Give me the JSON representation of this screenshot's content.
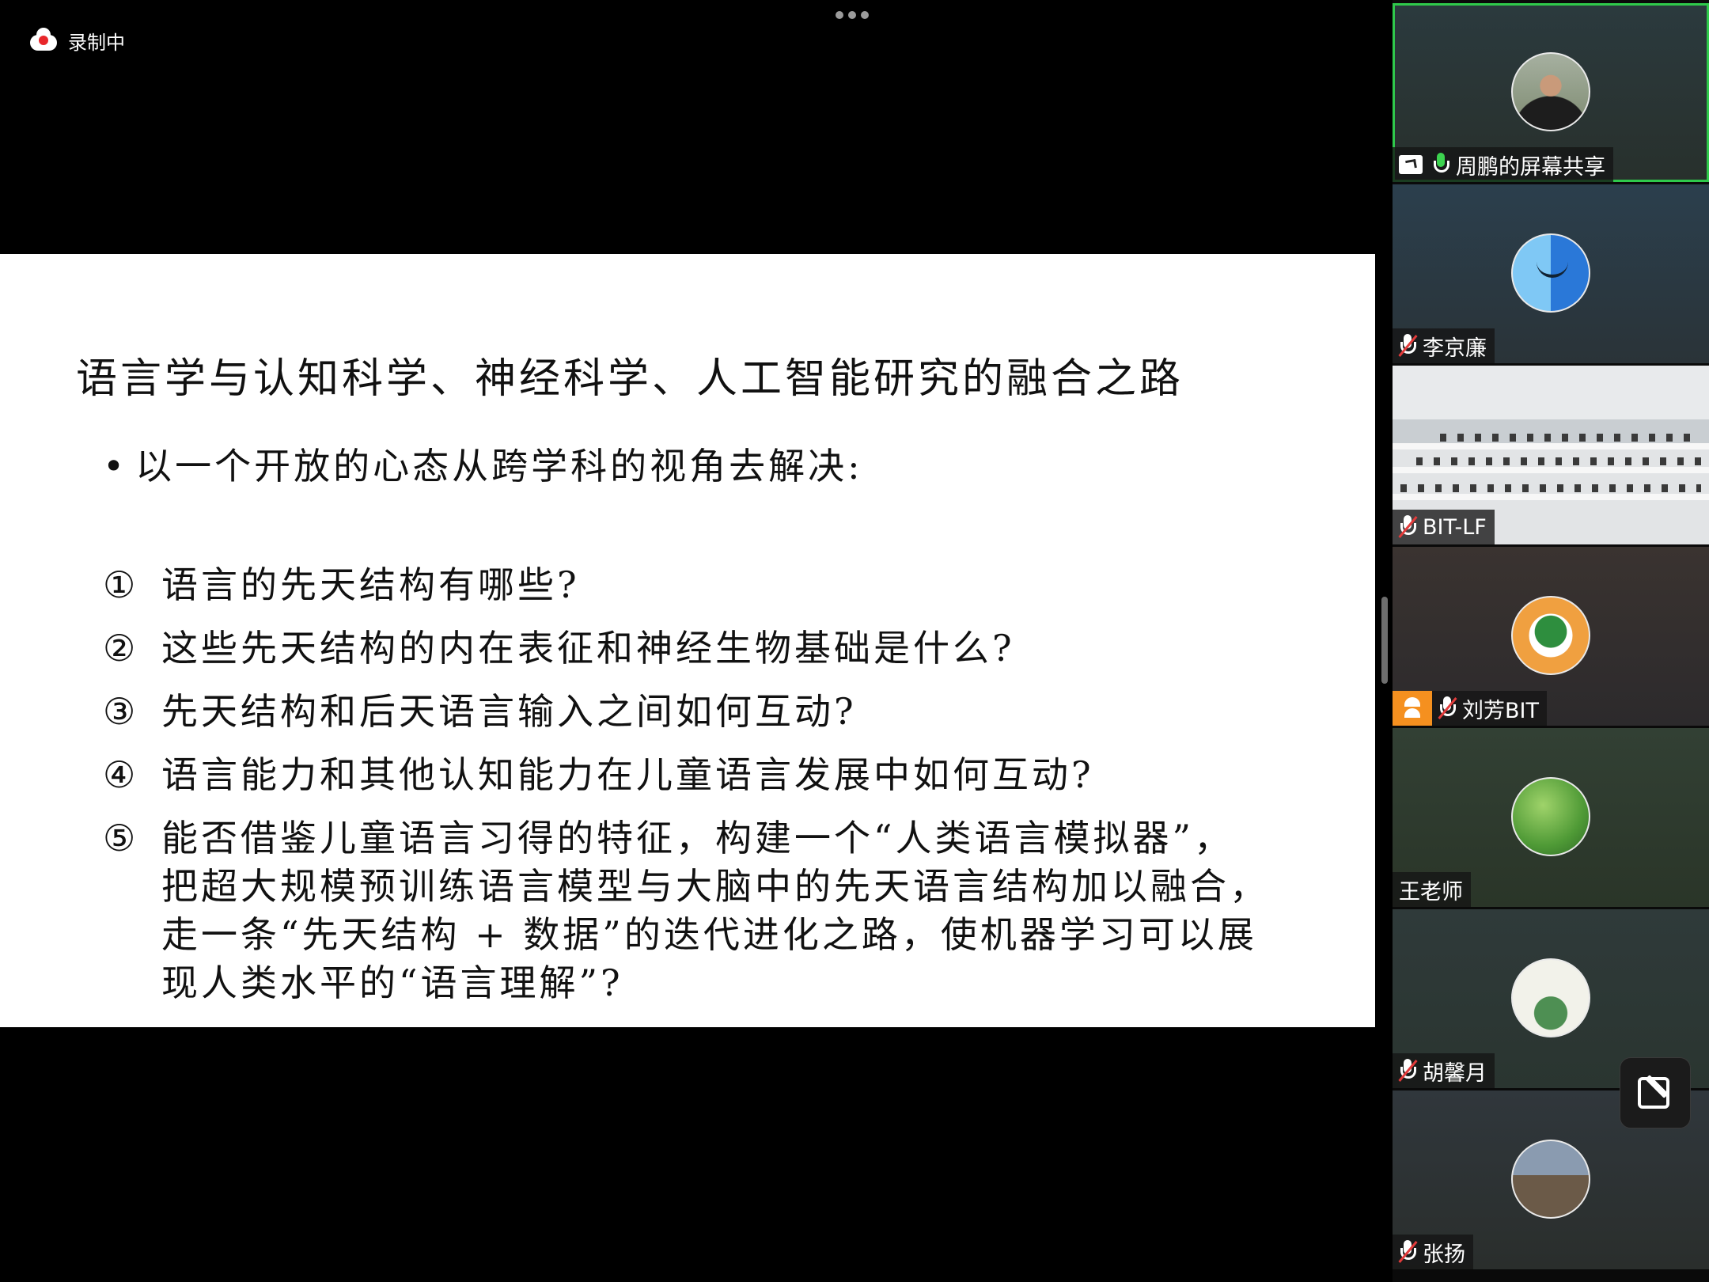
{
  "recording": {
    "label": "录制中"
  },
  "slide": {
    "title": "语言学与认知科学、神经科学、人工智能研究的融合之路",
    "bullet": "以一个开放的心态从跨学科的视角去解决:",
    "questions": [
      {
        "num": "①",
        "text": "语言的先天结构有哪些?"
      },
      {
        "num": "②",
        "text": "这些先天结构的内在表征和神经生物基础是什么?"
      },
      {
        "num": "③",
        "text": "先天结构和后天语言输入之间如何互动?"
      },
      {
        "num": "④",
        "text": "语言能力和其他认知能力在儿童语言发展中如何互动?"
      },
      {
        "num": "⑤",
        "text": "能否借鉴儿童语言习得的特征，构建一个“人类语言模拟器”，\n把超大规模预训练语言模型与大脑中的先天语言结构加以融合，\n走一条“先天结构 + 数据”的迭代进化之路，使机器学习可以展\n现人类水平的“语言理解”?"
      }
    ]
  },
  "participants": [
    {
      "name": "周鹏的屏幕共享",
      "mic": "on",
      "sharing": true,
      "active": true,
      "avatar": "man-portrait"
    },
    {
      "name": "李京廉",
      "mic": "muted",
      "avatar": "finder-icon"
    },
    {
      "name": "BIT-LF",
      "mic": "muted",
      "video": "classroom"
    },
    {
      "name": "刘芳BIT",
      "mic": "muted",
      "host": true,
      "avatar": "teacher-portrait"
    },
    {
      "name": "王老师",
      "mic": "none",
      "avatar": "leaf"
    },
    {
      "name": "胡馨月",
      "mic": "muted",
      "avatar": "globe-poster"
    },
    {
      "name": "张扬",
      "mic": "muted",
      "avatar": "tower"
    }
  ],
  "colors": {
    "active_border": "#2fc94b",
    "record_dot": "#e8262a",
    "host_badge": "#f5901f",
    "mic_muted": "#e23b3b"
  }
}
